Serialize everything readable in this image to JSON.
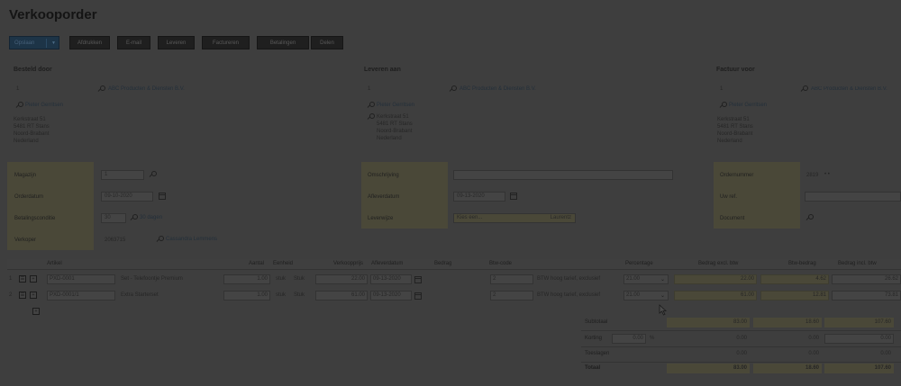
{
  "page": {
    "title": "Verkooporder"
  },
  "toolbar": {
    "buttons": [
      "Opslaan",
      "Afdrukken",
      "E-mail",
      "Leveren",
      "Factureren",
      "Betalingen",
      "Delen"
    ]
  },
  "parties": {
    "ordered_by": {
      "heading": "Besteld door",
      "code": "1",
      "company": "ABC Producten & Diensten B.V.",
      "contact": "Pieter Gerritsen",
      "address": [
        "Kerkstraat 51",
        "5481 RT Stans",
        "Noord-Brabant",
        "Nederland"
      ]
    },
    "deliver_to": {
      "heading": "Leveren aan",
      "code": "1",
      "company": "ABC Producten & Diensten B.V.",
      "contact": "Pieter Gerritsen",
      "address": [
        "Kerkstraat 51",
        "5481 RT Stans",
        "Noord-Brabant",
        "Nederland"
      ]
    },
    "invoice_to": {
      "heading": "Factuur voor",
      "code": "1",
      "company": "ABC Producten & Diensten B.V.",
      "contact": "Pieter Gerritsen",
      "address": [
        "Kerkstraat 51",
        "5481 RT Stans",
        "Noord-Brabant",
        "Nederland"
      ]
    }
  },
  "form": {
    "left": {
      "warehouse_label": "Magazijn",
      "warehouse_value": "1",
      "orderdate_label": "Orderdatum",
      "orderdate_value": "09-10-2020",
      "payment_label": "Betalingsconditie",
      "payment_value": "30",
      "payment_desc": "30 dagen",
      "seller_label": "Verkoper",
      "seller_value": "2063715",
      "seller_name": "Cassandra Lemmens"
    },
    "middle": {
      "desc_label": "Omschrijving",
      "deliverydate_label": "Afleverdatum",
      "deliverydate_value": "09-13-2020",
      "shipping_label": "Leverwijze",
      "shipping_placeholder": "Kies een...",
      "shipping_value": "Laurentz"
    },
    "right": {
      "ordernumber_label": "Ordernummer",
      "ordernumber_value": "2819",
      "ordernumber_suffix": "• •",
      "reference_label": "Uw ref.",
      "document_label": "Document"
    }
  },
  "grid": {
    "headers": {
      "item": "Artikel",
      "qty": "Aantal",
      "unit": "Eenheid",
      "price": "Verkoopprijs",
      "delivery": "Afleverdatum",
      "amount": "Bedrag",
      "vatcode": "Btw-code",
      "percentage": "Percentage",
      "excl": "Bedrag excl. btw",
      "vatamount": "Btw-bedrag",
      "incl": "Bedrag incl. btw"
    },
    "rows": [
      {
        "no": "1",
        "code": "PXD-0001",
        "desc": "Set - Telefoontje Premium",
        "qty": "1.00",
        "unit_code": "stuk",
        "unit": "Stuk",
        "price": "22.00",
        "date": "09-13-2020",
        "vat": "2",
        "vat_desc": "BTW hoog tarief, exclusief",
        "pct": "21.00",
        "excl": "22.00",
        "vatamt": "4.62",
        "incl": "26.62"
      },
      {
        "no": "2",
        "code": "PXD-0001/1",
        "desc": "Extra Starterset",
        "qty": "1.00",
        "unit_code": "stuk",
        "unit": "Stuk",
        "price": "61.00",
        "date": "09-13-2020",
        "vat": "2",
        "vat_desc": "BTW hoog tarief, exclusief",
        "pct": "21.00",
        "excl": "61.00",
        "vatamt": "12.81",
        "incl": "73.81"
      }
    ]
  },
  "totals": {
    "subtotal_label": "Subtotaal",
    "subtotal": [
      "83.00",
      "18.60",
      "107.60"
    ],
    "discount_label": "Korting",
    "discount_pct": "0.00",
    "discount_pct_unit": "%",
    "discount": [
      "0.00",
      "0.00",
      "0.00"
    ],
    "rounding_label": "Toeslagen",
    "rounding": [
      "0.00",
      "0.00",
      "0.00"
    ],
    "total_label": "Totaal",
    "total": [
      "83.00",
      "18.60",
      "107.60"
    ]
  }
}
